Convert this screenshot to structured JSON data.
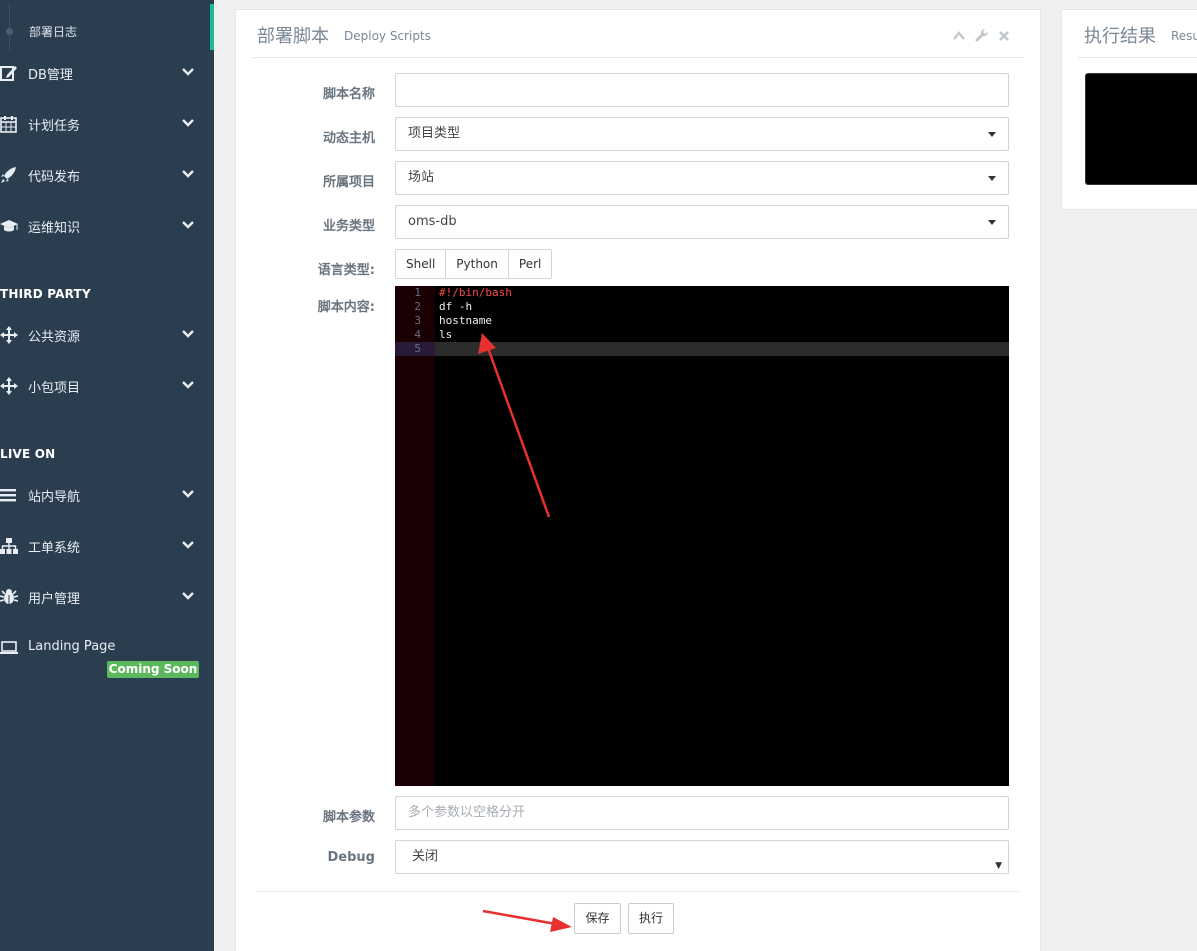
{
  "sidebar": {
    "active_sub": "部署日志",
    "items": [
      {
        "label": "DB管理",
        "icon": "edit-icon"
      },
      {
        "label": "计划任务",
        "icon": "calendar-icon"
      },
      {
        "label": "代码发布",
        "icon": "rocket-icon"
      },
      {
        "label": "运维知识",
        "icon": "graduation-cap-icon"
      }
    ],
    "header_third_party": "THIRD PARTY",
    "third_party": [
      {
        "label": "公共资源",
        "icon": "move-icon"
      },
      {
        "label": "小包项目",
        "icon": "move-icon"
      }
    ],
    "header_live_on": "LIVE ON",
    "live_on": [
      {
        "label": "站内导航",
        "icon": "list-icon"
      },
      {
        "label": "工单系统",
        "icon": "sitemap-icon"
      },
      {
        "label": "用户管理",
        "icon": "bug-icon"
      }
    ],
    "landing_page": "Landing Page",
    "coming_soon": "Coming Soon"
  },
  "panel": {
    "title": "部署脚本",
    "subtitle": "Deploy Scripts"
  },
  "form": {
    "script_name_label": "脚本名称",
    "script_name_value": "",
    "dynamic_host_label": "动态主机",
    "dynamic_host_value": "项目类型",
    "project_label": "所属项目",
    "project_value": "场站",
    "business_type_label": "业务类型",
    "business_type_value": "oms-db",
    "lang_label": "语言类型:",
    "lang_options": [
      "Shell",
      "Python",
      "Perl"
    ],
    "content_label": "脚本内容:",
    "code_lines": [
      "#!/bin/bash",
      "df -h",
      "hostname",
      "ls",
      ""
    ],
    "line_numbers": [
      "1",
      "2",
      "3",
      "4",
      "5"
    ],
    "params_label": "脚本参数",
    "params_placeholder": "多个参数以空格分开",
    "debug_label": "Debug",
    "debug_value": "关闭",
    "save_label": "保存",
    "execute_label": "执行"
  },
  "result_panel": {
    "title": "执行结果",
    "subtitle": "Resu"
  }
}
